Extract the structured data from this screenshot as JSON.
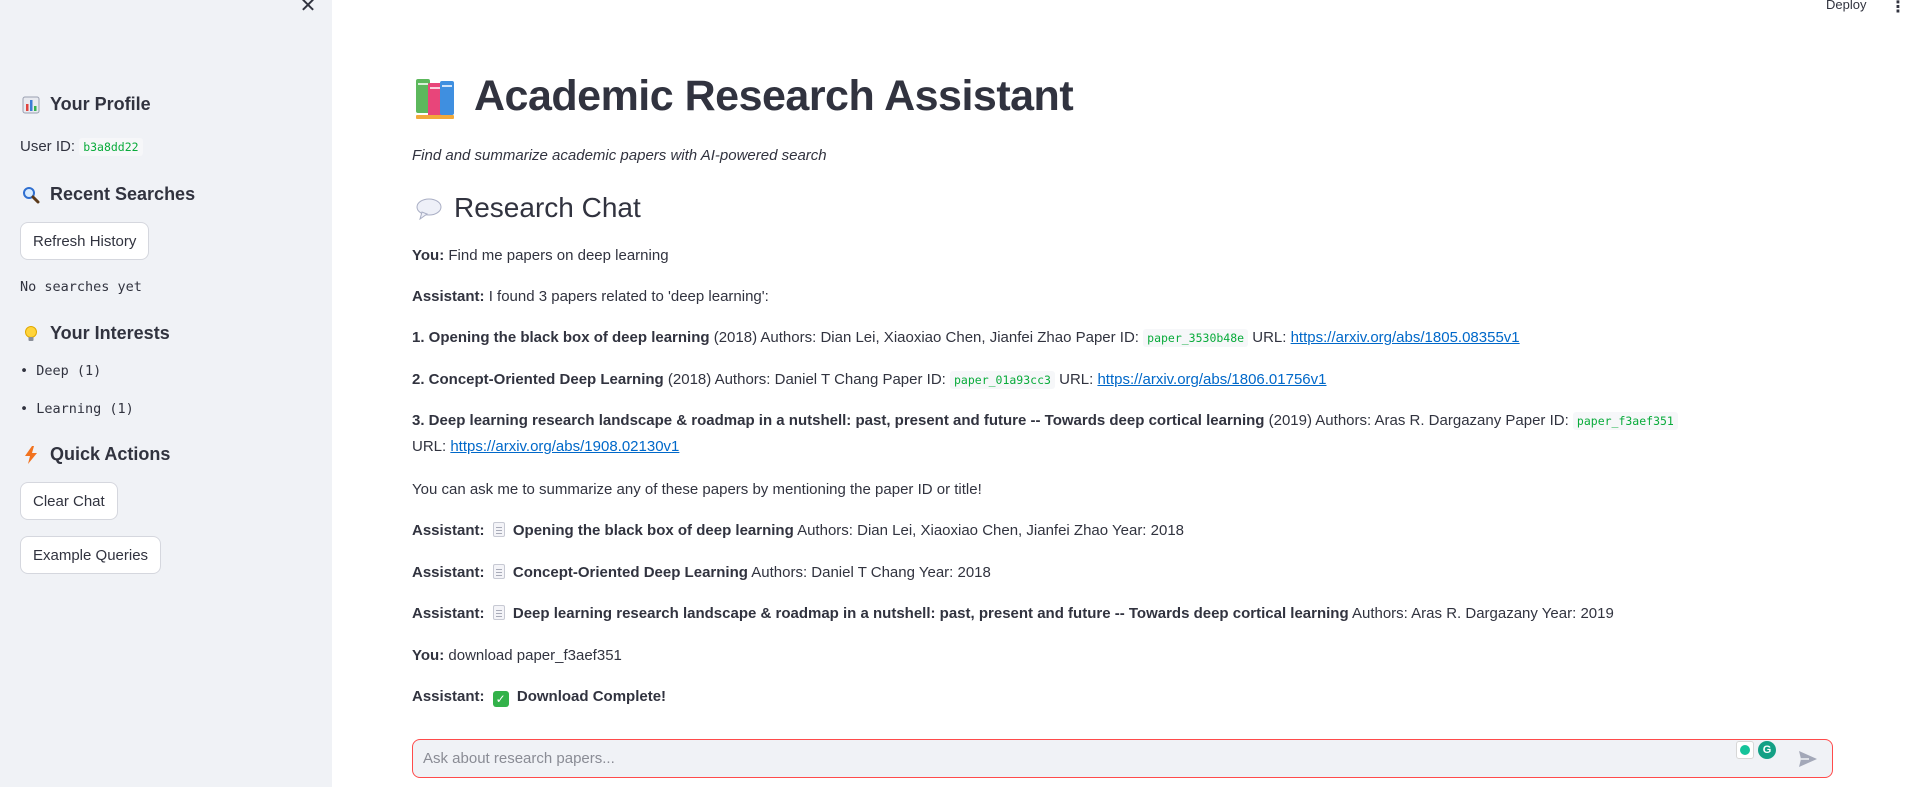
{
  "sidebar": {
    "close_glyph": "✕",
    "profile": {
      "title": "Your Profile",
      "icon": "bar-chart-emoji",
      "user_id_label": "User ID:",
      "user_id": "b3a8dd22"
    },
    "recent": {
      "title": "Recent Searches",
      "icon": "magnifier-emoji",
      "refresh_label": "Refresh History",
      "empty_text": "No searches yet"
    },
    "interests": {
      "title": "Your Interests",
      "icon": "lightbulb-emoji",
      "items": [
        "• Deep (1)",
        "• Learning (1)"
      ]
    },
    "actions": {
      "title": "Quick Actions",
      "icon": "lightning-emoji",
      "clear_label": "Clear Chat",
      "examples_label": "Example Queries"
    }
  },
  "topbar": {
    "deploy_label": "Deploy",
    "menu_glyph": "⋮"
  },
  "main": {
    "title": "Academic Research Assistant",
    "title_icon": "books-emoji",
    "subtitle": "Find and summarize academic papers with AI-powered search",
    "chat_title": "Research Chat",
    "chat_icon": "speech-bubble-emoji"
  },
  "chat": {
    "you_label": "You:",
    "assistant_label": "Assistant:",
    "m1_text": "Find me papers on deep learning",
    "m2_text": "I found 3 papers related to 'deep learning':",
    "papers": [
      {
        "title": "1. Opening the black box of deep learning",
        "details": " (2018) Authors: Dian Lei, Xiaoxiao Chen, Jianfei Zhao Paper ID: ",
        "id": "paper_3530b48e",
        "url_label": " URL: ",
        "url": "https://arxiv.org/abs/1805.08355v1"
      },
      {
        "title": "2. Concept-Oriented Deep Learning",
        "details": " (2018) Authors: Daniel T Chang Paper ID: ",
        "id": "paper_01a93cc3",
        "url_label": " URL: ",
        "url": "https://arxiv.org/abs/1806.01756v1"
      },
      {
        "title": "3. Deep learning research landscape & roadmap in a nutshell: past, present and future -- Towards deep cortical learning",
        "details": " (2019) Authors: Aras R. Dargazany Paper ID: ",
        "id": "paper_f3aef351",
        "url_label": " URL: ",
        "url": "https://arxiv.org/abs/1908.02130v1"
      }
    ],
    "hint": "You can ask me to summarize any of these papers by mentioning the paper ID or title!",
    "summaries": [
      {
        "title": "Opening the black box of deep learning",
        "details": " Authors: Dian Lei, Xiaoxiao Chen, Jianfei Zhao Year: 2018"
      },
      {
        "title": "Concept-Oriented Deep Learning",
        "details": " Authors: Daniel T Chang Year: 2018"
      },
      {
        "title": "Deep learning research landscape & roadmap in a nutshell: past, present and future -- Towards deep cortical learning",
        "details": " Authors: Aras R. Dargazany Year: 2019"
      }
    ],
    "m_download": "download paper_f3aef351",
    "m_complete": "Download Complete!",
    "input_placeholder": "Ask about research papers..."
  },
  "colors": {
    "accent": "#ff4b4b",
    "link": "#0068c9",
    "code": "#09ab3b",
    "sidebar_bg": "#f0f2f6"
  }
}
